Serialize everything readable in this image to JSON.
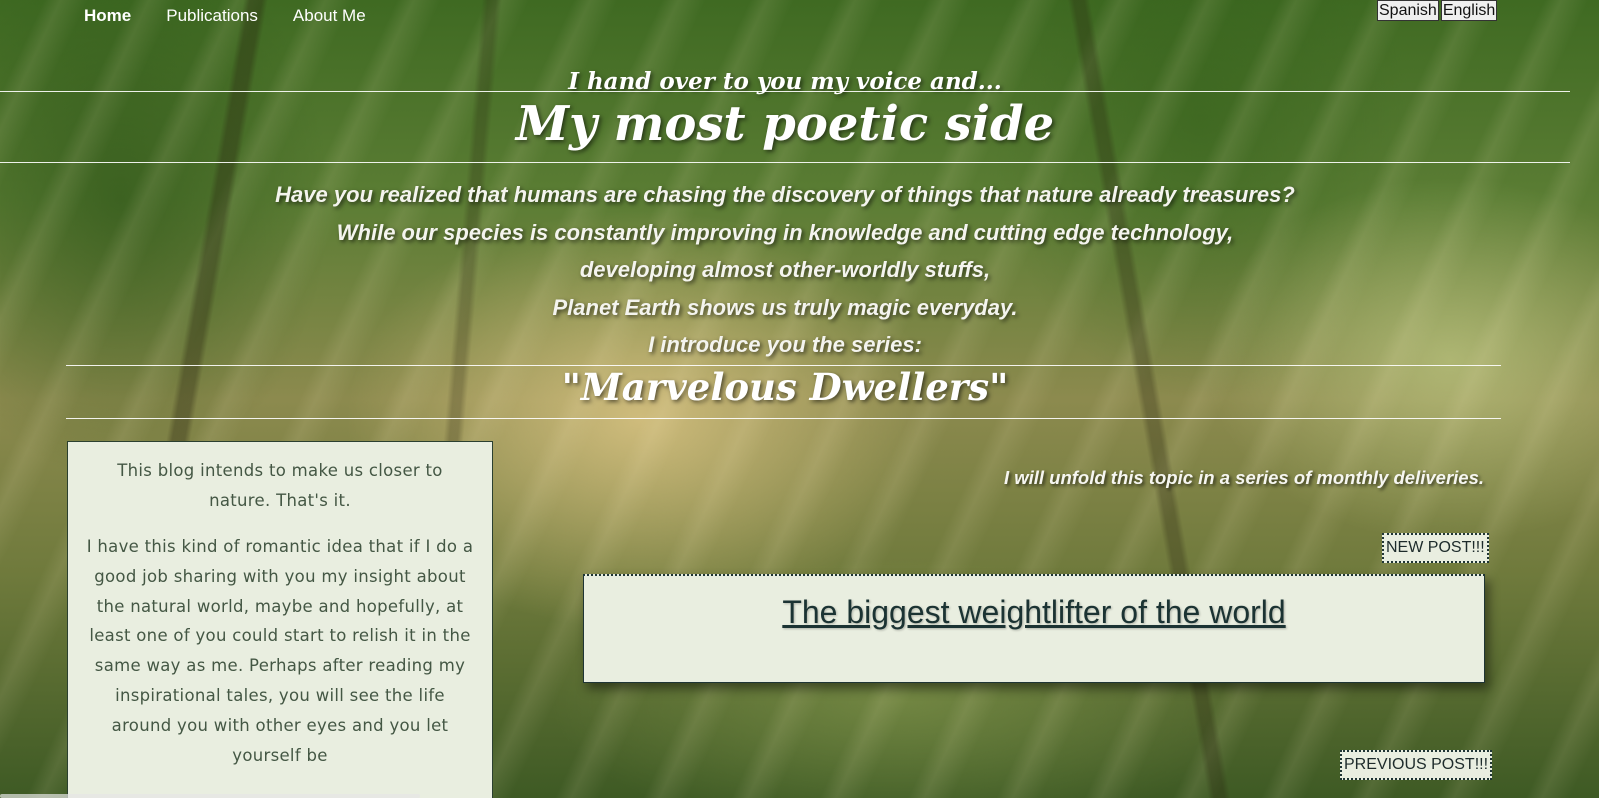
{
  "nav": {
    "items": [
      {
        "label": "Home",
        "active": true
      },
      {
        "label": "Publications",
        "active": false
      },
      {
        "label": "About Me",
        "active": false
      }
    ]
  },
  "languages": {
    "spanish": "Spanish",
    "english": "English"
  },
  "header": {
    "intro": "I hand over to you my voice and...",
    "title": "My most poetic side"
  },
  "lead": {
    "lines": [
      "Have you realized that humans are chasing the discovery of things that nature already treasures?",
      "While our species is constantly improving in knowledge and cutting edge technology,",
      "developing almost other-worldly stuffs,",
      "Planet Earth shows us truly magic everyday.",
      "I introduce you the series:"
    ]
  },
  "series": {
    "title": "\"Marvelous Dwellers\""
  },
  "sidebar": {
    "para1": "This blog intends to make us closer to nature. That's it.",
    "para2": "I have this kind of romantic idea that if I do a good job sharing with you my insight about the natural world, maybe and hopefully, at least one of you could start to relish it in the same way as me. Perhaps after reading my inspirational tales, you will see the life around you with other eyes and you let yourself be"
  },
  "main": {
    "unfold": "I will unfold this topic in a series of monthly deliveries.",
    "new_post_label": "NEW POST!!!",
    "post_title": "The biggest weightlifter of the world",
    "previous_post_label": "PREVIOUS POST!!!"
  }
}
